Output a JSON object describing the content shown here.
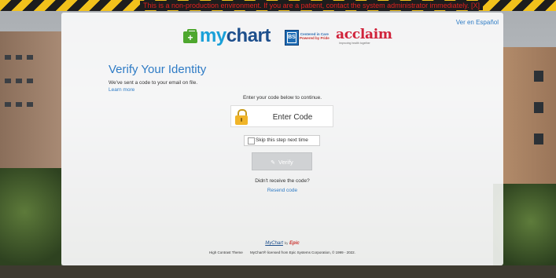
{
  "banner": {
    "message": "This is a non-production environment. If you are a patient, contact the system administrator immediately. [X]"
  },
  "header": {
    "language_link": "Ver en Español",
    "logo_mychart": {
      "my": "my",
      "chart": "chart"
    },
    "logo_bs": {
      "text": "BS"
    },
    "logo_tagline": {
      "line1": "Centered in Care",
      "line2": "Powered by Pride"
    },
    "logo_acclaim": {
      "name": "acclaim",
      "sub": "Improving health together"
    }
  },
  "main": {
    "title": "Verify Your Identity",
    "sent_text": "We've sent a code to your email on file.",
    "learn_more": "Learn more",
    "prompt": "Enter your code below to continue.",
    "code_placeholder": "Enter Code",
    "skip_label": "Skip this step next time",
    "verify_label": "Verify",
    "didnt_receive": "Didn't receive the code?",
    "resend": "Resend code"
  },
  "footer": {
    "mychart_logo": "MyChart",
    "by": "by",
    "epic": "Epic",
    "high_contrast": "High Contrast Theme",
    "license": "MyChart® licensed from Epic Systems Corporation, © 1999 - 2022."
  },
  "colors": {
    "accent": "#2e7bc5",
    "mychart_green": "#4ea72e",
    "acclaim_red": "#d0223a",
    "banner_yellow": "#f2c21b"
  },
  "icons": [
    "lock-icon",
    "pencil-icon",
    "checkbox-icon",
    "mychart-bag-icon"
  ]
}
